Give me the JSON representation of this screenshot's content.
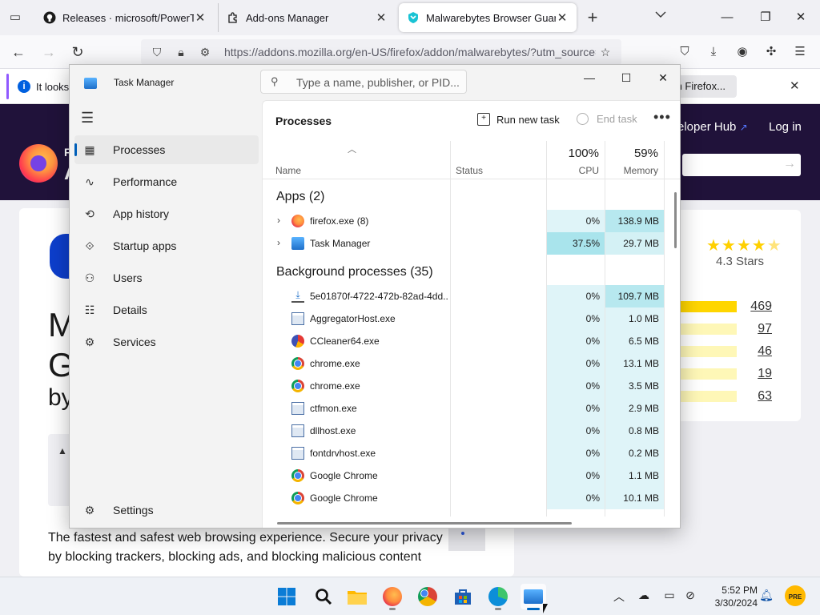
{
  "firefox": {
    "tabs": [
      {
        "label": "Releases · microsoft/PowerToys",
        "icon": "github-icon"
      },
      {
        "label": "Add-ons Manager",
        "icon": "puzzle-icon"
      },
      {
        "label": "Malwarebytes Browser Guard –",
        "icon": "malwarebytes-icon",
        "active": true
      }
    ],
    "url": "https://addons.mozilla.org/en-US/firefox/addon/malwarebytes/?utm_source=a",
    "notification": {
      "text": "It looks",
      "button": "h Firefox..."
    }
  },
  "amo": {
    "header": {
      "logo_letter_top": "F",
      "logo_letter_bottom": "A",
      "dev_hub": "eloper Hub",
      "login": "Log in"
    },
    "card": {
      "title_frag_1": "M",
      "title_frag_2": "G",
      "title_frag_3": "by",
      "description": "The fastest and safest web browsing experience. Secure your privacy by blocking trackers, blocking ads, and blocking malicious content"
    },
    "ratings": {
      "stars_label": "4.3 Stars",
      "stars_value": 4.3,
      "rows": [
        {
          "count": "469",
          "fill": 1.0
        },
        {
          "count": "97",
          "fill": 0.0
        },
        {
          "count": "46",
          "fill": 0.0
        },
        {
          "count": "19",
          "fill": 0.0
        },
        {
          "count": "63",
          "fill": 0.0
        }
      ]
    }
  },
  "taskmanager": {
    "title": "Task Manager",
    "search_placeholder": "Type a name, publisher, or PID...",
    "nav": [
      {
        "label": "Processes",
        "icon": "processes-icon",
        "active": true
      },
      {
        "label": "Performance",
        "icon": "performance-icon"
      },
      {
        "label": "App history",
        "icon": "history-icon"
      },
      {
        "label": "Startup apps",
        "icon": "startup-icon"
      },
      {
        "label": "Users",
        "icon": "users-icon"
      },
      {
        "label": "Details",
        "icon": "details-icon"
      },
      {
        "label": "Services",
        "icon": "services-icon"
      }
    ],
    "settings_label": "Settings",
    "content": {
      "title": "Processes",
      "run_new_task": "Run new task",
      "end_task": "End task",
      "columns": {
        "name": "Name",
        "status": "Status",
        "cpu_pct": "100%",
        "cpu": "CPU",
        "mem_pct": "59%",
        "memory": "Memory"
      },
      "apps_group": "Apps (2)",
      "bg_group": "Background processes (35)",
      "apps": [
        {
          "name": "firefox.exe (8)",
          "icon": "firefox-icon",
          "cpu": "0%",
          "mem": "138.9 MB",
          "cpu_heat": "#dff4f8",
          "mem_heat": "#b7e8ef"
        },
        {
          "name": "Task Manager",
          "icon": "taskmanager-icon",
          "cpu": "37.5%",
          "mem": "29.7 MB",
          "cpu_heat": "#a9e4ec",
          "mem_heat": "#d4f1f5"
        }
      ],
      "background": [
        {
          "name": "5e01870f-4722-472b-82ad-4dd...",
          "icon": "download-icon",
          "cpu": "0%",
          "mem": "109.7 MB",
          "cpu_heat": "#dff4f8",
          "mem_heat": "#b7e8ef"
        },
        {
          "name": "AggregatorHost.exe",
          "icon": "window-icon",
          "cpu": "0%",
          "mem": "1.0 MB",
          "cpu_heat": "#dff4f8",
          "mem_heat": "#dff4f8"
        },
        {
          "name": "CCleaner64.exe",
          "icon": "ccleaner-icon",
          "cpu": "0%",
          "mem": "6.5 MB",
          "cpu_heat": "#dff4f8",
          "mem_heat": "#dff4f8"
        },
        {
          "name": "chrome.exe",
          "icon": "chrome-icon",
          "cpu": "0%",
          "mem": "13.1 MB",
          "cpu_heat": "#dff4f8",
          "mem_heat": "#dff4f8"
        },
        {
          "name": "chrome.exe",
          "icon": "chrome-icon",
          "cpu": "0%",
          "mem": "3.5 MB",
          "cpu_heat": "#dff4f8",
          "mem_heat": "#dff4f8"
        },
        {
          "name": "ctfmon.exe",
          "icon": "window-icon",
          "cpu": "0%",
          "mem": "2.9 MB",
          "cpu_heat": "#dff4f8",
          "mem_heat": "#dff4f8"
        },
        {
          "name": "dllhost.exe",
          "icon": "window-icon",
          "cpu": "0%",
          "mem": "0.8 MB",
          "cpu_heat": "#dff4f8",
          "mem_heat": "#dff4f8"
        },
        {
          "name": "fontdrvhost.exe",
          "icon": "window-icon",
          "cpu": "0%",
          "mem": "0.2 MB",
          "cpu_heat": "#dff4f8",
          "mem_heat": "#dff4f8"
        },
        {
          "name": "Google Chrome",
          "icon": "chrome-icon",
          "cpu": "0%",
          "mem": "1.1 MB",
          "cpu_heat": "#dff4f8",
          "mem_heat": "#dff4f8"
        },
        {
          "name": "Google Chrome",
          "icon": "chrome-icon",
          "cpu": "0%",
          "mem": "10.1 MB",
          "cpu_heat": "#dff4f8",
          "mem_heat": "#dff4f8"
        }
      ]
    }
  },
  "taskbar": {
    "apps": [
      "start-icon",
      "search-icon",
      "file-explorer-icon",
      "firefox-icon",
      "chrome-icon",
      "store-icon",
      "edge-icon",
      "taskmanager-icon"
    ],
    "clock": {
      "time": "5:52 PM",
      "date": "3/30/2024"
    },
    "badge": "PRE"
  }
}
